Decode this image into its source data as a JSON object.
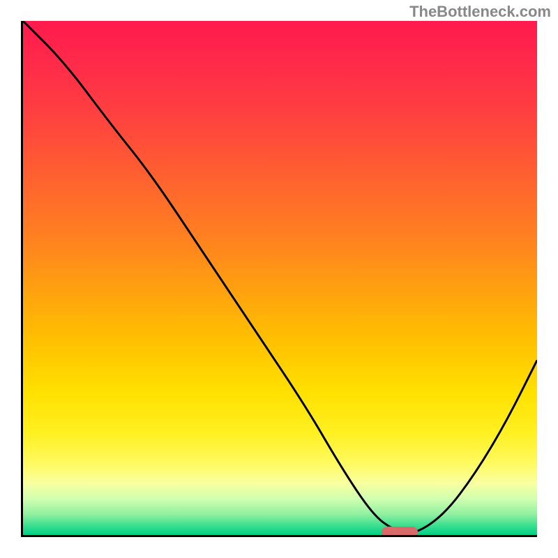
{
  "watermark": "TheBottleneck.com",
  "chart_data": {
    "type": "line",
    "title": "",
    "xlabel": "",
    "ylabel": "",
    "xlim": [
      0,
      100
    ],
    "ylim": [
      0,
      100
    ],
    "grid": false,
    "series": [
      {
        "name": "curve",
        "x": [
          0,
          8,
          17,
          25,
          35,
          45,
          55,
          62,
          68,
          72,
          76,
          82,
          88,
          94,
          100
        ],
        "values": [
          100,
          92,
          80,
          70,
          55,
          40,
          25,
          13,
          4,
          1,
          0,
          4,
          12,
          22,
          34
        ]
      }
    ],
    "marker": {
      "x_center": 73,
      "y": 1,
      "width_pct": 7
    },
    "background_gradient": {
      "stops": [
        {
          "pct": 0,
          "color": "#ff1a4d"
        },
        {
          "pct": 50,
          "color": "#ffa010"
        },
        {
          "pct": 80,
          "color": "#fff020"
        },
        {
          "pct": 100,
          "color": "#00d084"
        }
      ]
    }
  }
}
